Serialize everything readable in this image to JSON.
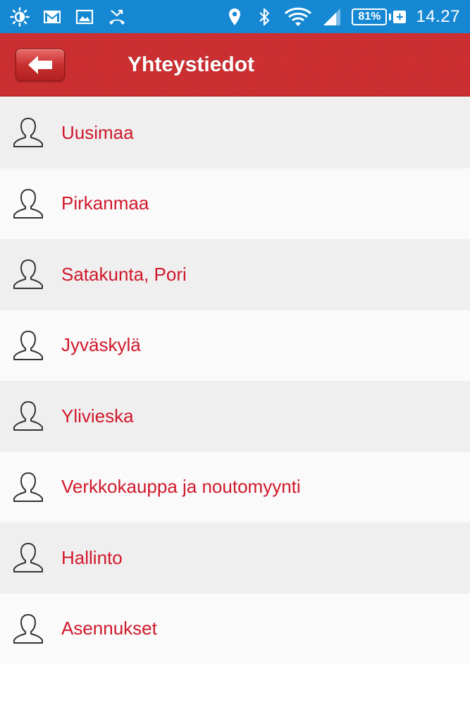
{
  "status_bar": {
    "battery_percent": "81%",
    "battery_level": 0.81,
    "time": "14.27",
    "icons": [
      "brightness-icon",
      "gmail-icon",
      "image-icon",
      "missed-call-icon",
      "location-icon",
      "bluetooth-icon",
      "wifi-icon",
      "signal-icon",
      "battery-icon",
      "charging-icon"
    ]
  },
  "header": {
    "title": "Yhteystiedot",
    "back_icon": "back-arrow-icon",
    "background_color": "#d23032"
  },
  "contacts": {
    "item_icon": "person-icon",
    "label_color": "#d0182b",
    "items": [
      {
        "label": "Uusimaa"
      },
      {
        "label": "Pirkanmaa"
      },
      {
        "label": "Satakunta, Pori"
      },
      {
        "label": "Jyväskylä"
      },
      {
        "label": "Ylivieska"
      },
      {
        "label": "Verkkokauppa ja noutomyynti"
      },
      {
        "label": "Hallinto"
      },
      {
        "label": "Asennukset"
      }
    ]
  }
}
